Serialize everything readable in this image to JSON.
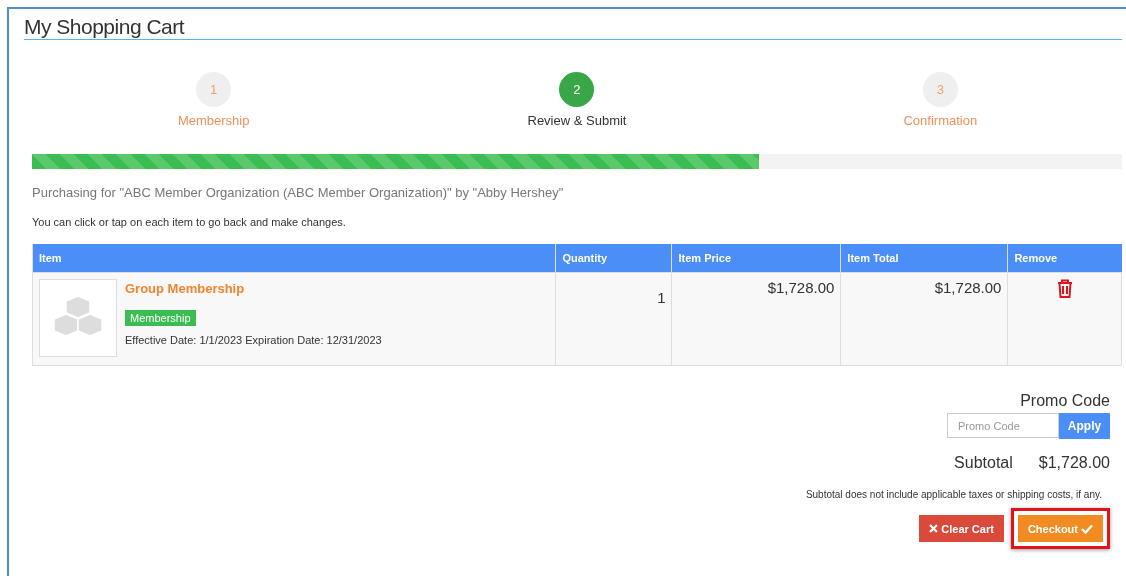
{
  "title": "My Shopping Cart",
  "steps": [
    {
      "number": "1",
      "label": "Membership",
      "selected": false
    },
    {
      "number": "2",
      "label": "Review & Submit",
      "selected": true
    },
    {
      "number": "3",
      "label": "Confirmation",
      "selected": false
    }
  ],
  "progress": {
    "level": 0.667
  },
  "purchasing_note": "Purchasing for \"ABC Member Organization (ABC Member Organization)\" by \"Abby Hershey\"",
  "hint": "You can click or tap on each item to go back and make changes.",
  "table": {
    "columns": [
      "Item",
      "Quantity",
      "Item Price",
      "Item Total",
      "Remove"
    ],
    "rows": [
      {
        "name": "Group Membership",
        "tag": "Membership",
        "dates": "Effective Date: 1/1/2023 Expiration Date: 12/31/2023",
        "quantity": "1",
        "price": "$1,728.00",
        "total": "$1,728.00"
      }
    ]
  },
  "promo": {
    "label": "Promo Code",
    "placeholder": "Promo Code",
    "button": "Apply"
  },
  "subtotal": {
    "label": "Subtotal",
    "value": "$1,728.00",
    "note": "Subtotal does not include applicable taxes or shipping costs, if any."
  },
  "buttons": [
    {
      "kind": "clear",
      "label": "Clear Cart",
      "highlighted": false
    },
    {
      "kind": "checkout",
      "label": "Checkout",
      "highlighted": true
    }
  ]
}
